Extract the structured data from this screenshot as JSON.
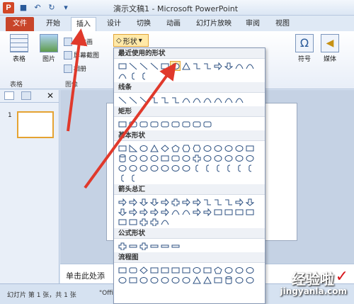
{
  "titlebar": {
    "title": "演示文稿1 - Microsoft PowerPoint",
    "app_icon": "P"
  },
  "tabs": [
    {
      "label": "文件"
    },
    {
      "label": "开始"
    },
    {
      "label": "插入"
    },
    {
      "label": "设计"
    },
    {
      "label": "切换"
    },
    {
      "label": "动画"
    },
    {
      "label": "幻灯片放映"
    },
    {
      "label": "审阅"
    },
    {
      "label": "视图"
    }
  ],
  "ribbon": {
    "table_label": "表格",
    "table_group": "表格",
    "picture_label": "图片",
    "clipart_label": "剪贴画",
    "screenshot_label": "屏幕截图",
    "album_label": "相册",
    "image_group": "图像",
    "shapes_label": "形状",
    "symbol_label": "符号",
    "media_label": "媒体"
  },
  "dropdown": {
    "sections": [
      {
        "title": "最近使用的形状"
      },
      {
        "title": "线条"
      },
      {
        "title": "矩形"
      },
      {
        "title": "基本形状"
      },
      {
        "title": "箭头总汇"
      },
      {
        "title": "公式形状"
      },
      {
        "title": "流程图"
      }
    ]
  },
  "left_panel": {
    "slide_number": "1"
  },
  "notes": {
    "placeholder": "单击此处添"
  },
  "status": {
    "slide_info": "幻灯片 第 1 张，共 1 张",
    "theme": "\"Offi"
  },
  "watermark": {
    "text": "经验啦",
    "check": "✓",
    "url": "jingyanla.com"
  },
  "colors": {
    "accent": "#e5a332",
    "file_tab": "#c8452a",
    "arrow": "#e0392b"
  }
}
